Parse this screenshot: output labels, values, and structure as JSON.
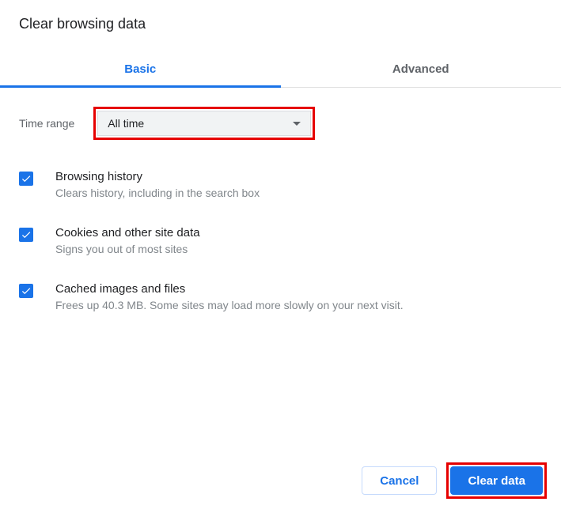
{
  "dialog": {
    "title": "Clear browsing data"
  },
  "tabs": {
    "basic": "Basic",
    "advanced": "Advanced"
  },
  "timeRange": {
    "label": "Time range",
    "value": "All time"
  },
  "options": [
    {
      "title": "Browsing history",
      "desc": "Clears history, including in the search box",
      "checked": true
    },
    {
      "title": "Cookies and other site data",
      "desc": "Signs you out of most sites",
      "checked": true
    },
    {
      "title": "Cached images and files",
      "desc": "Frees up 40.3 MB. Some sites may load more slowly on your next visit.",
      "checked": true
    }
  ],
  "buttons": {
    "cancel": "Cancel",
    "clear": "Clear data"
  }
}
